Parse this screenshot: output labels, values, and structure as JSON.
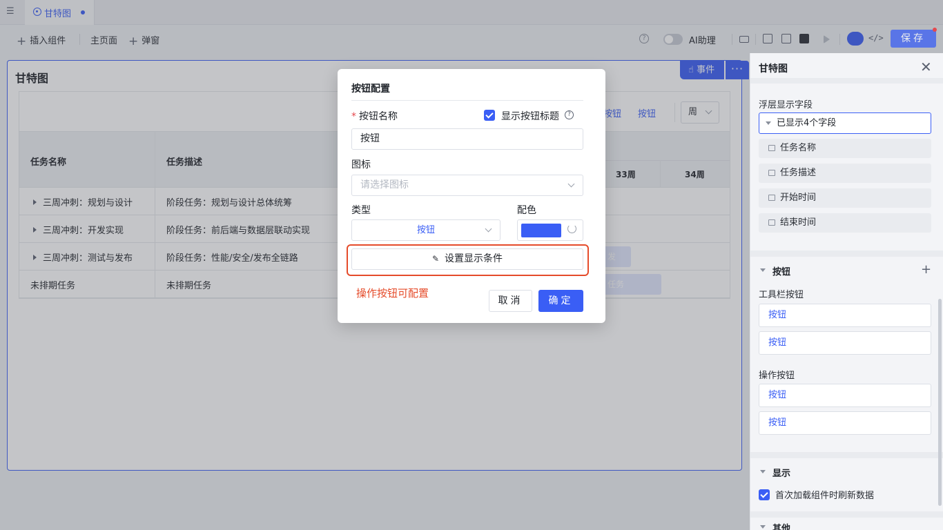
{
  "tabs": [
    {
      "label": "甘特图",
      "unsaved": true
    }
  ],
  "toolbar": {
    "insert_component": "插入组件",
    "main_page": "主页面",
    "popup": "弹窗",
    "ai_assistant": "AI助理",
    "ai_enabled": false,
    "code_glyph": "</>",
    "save": "保存"
  },
  "card": {
    "title": "甘特图",
    "event_chip": "事件",
    "more_chip": "···",
    "gantt": {
      "header_buttons": [
        "按钮",
        "按钮"
      ],
      "scale_select": "周",
      "columns": [
        "任务名称",
        "任务描述"
      ],
      "weeks": [
        "33周",
        "34周"
      ],
      "rows": [
        {
          "name": "三周冲刺：规划与设计",
          "desc": "阶段任务：规划与设计总体统筹",
          "expandable": true
        },
        {
          "name": "三周冲刺：开发实现",
          "desc": "阶段任务：前后端与数据层联动实现",
          "expandable": true
        },
        {
          "name": "三周冲刺：测试与发布",
          "desc": "阶段任务：性能/安全/发布全链路",
          "expandable": true
        },
        {
          "name": "未排期任务",
          "desc": "未排期任务",
          "expandable": false
        }
      ],
      "bars": [
        "发布...",
        "任务"
      ]
    }
  },
  "panel": {
    "title": "甘特图",
    "popup_fields_label": "浮层显示字段",
    "popup_fields_value": "已显示4个字段",
    "fields": [
      "任务名称",
      "任务描述",
      "开始时间",
      "结束时间"
    ],
    "buttons_section": "按钮",
    "toolbar_buttons_label": "工具栏按钮",
    "toolbar_buttons": [
      "按钮",
      "按钮"
    ],
    "action_buttons_label": "操作按钮",
    "action_buttons": [
      "按钮",
      "按钮"
    ],
    "display_section": "显示",
    "refresh_on_load": "首次加载组件时刷新数据",
    "refresh_on_load_checked": true,
    "other_section": "其他"
  },
  "modal": {
    "title": "按钮配置",
    "name_label": "按钮名称",
    "show_title_label": "显示按钮标题",
    "show_title_checked": true,
    "name_value": "按钮",
    "icon_label": "图标",
    "icon_placeholder": "请选择图标",
    "type_label": "类型",
    "type_value": "按钮",
    "color_label": "配色",
    "color_value": "#3a5ef5",
    "condition_button": "设置显示条件",
    "annotation": "操作按钮可配置",
    "cancel": "取消",
    "ok": "确定"
  },
  "colors": {
    "accent": "#3a5ef5",
    "annotation": "#e54b2a"
  }
}
